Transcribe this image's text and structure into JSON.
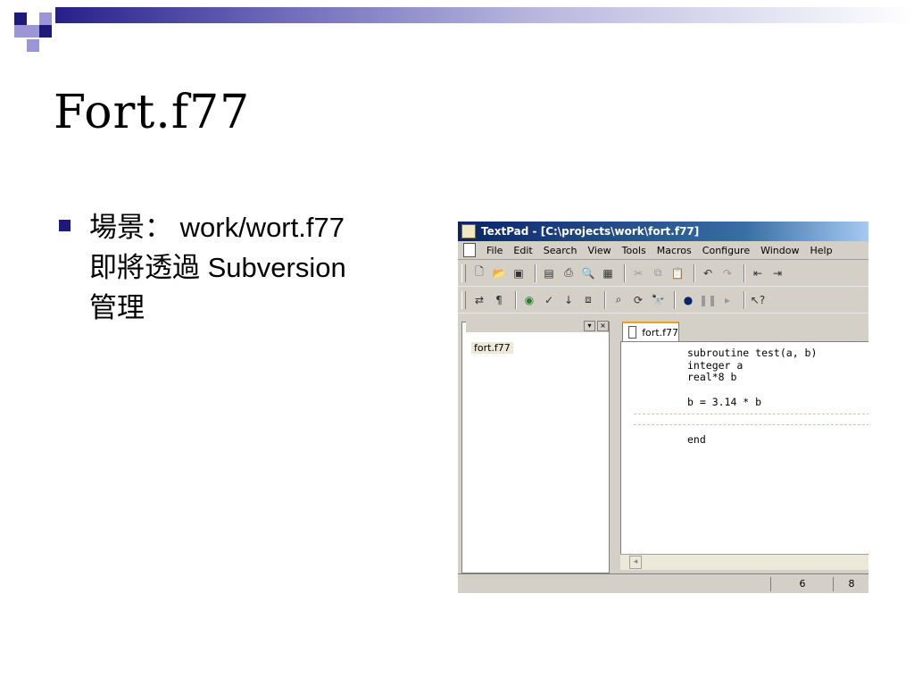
{
  "slide": {
    "title": "Fort.f77",
    "bullet_line1": "場景： work/wort.f77",
    "bullet_line2": "即將透過 Subversion",
    "bullet_line3": "管理"
  },
  "window": {
    "title": "TextPad - [C:\\projects\\work\\fort.f77]",
    "menu": [
      "File",
      "Edit",
      "Search",
      "View",
      "Tools",
      "Macros",
      "Configure",
      "Window",
      "Help"
    ]
  },
  "toolbar": {
    "row1": [
      "new-icon",
      "open-icon",
      "save-icon",
      "print-setup-icon",
      "print-icon",
      "print-preview-icon",
      "manage-files-icon",
      "cut-icon",
      "copy-icon",
      "paste-icon",
      "undo-icon",
      "redo-icon",
      "indent-icon",
      "outdent-icon"
    ],
    "row2": [
      "word-wrap-icon",
      "paragraph-icon",
      "web-icon",
      "spellcheck-icon",
      "sort-icon",
      "compare-icon",
      "find-icon",
      "replace-icon",
      "find-in-files-icon",
      "record-macro-icon",
      "pause-macro-icon",
      "play-macro-icon",
      "help-pointer-icon"
    ]
  },
  "side_panel": {
    "file": "fort.f77"
  },
  "editor": {
    "tab_label": "fort.f77",
    "lines": [
      "subroutine test(a, b)",
      "integer a",
      "real*8 b",
      "b = 3.14 * b",
      "end"
    ]
  },
  "statusbar": {
    "line": "6",
    "column": "8"
  },
  "colors": {
    "slide_accent": "#1f1a7a",
    "titlebar": "#0a246a",
    "chrome": "#d4d0c8"
  }
}
